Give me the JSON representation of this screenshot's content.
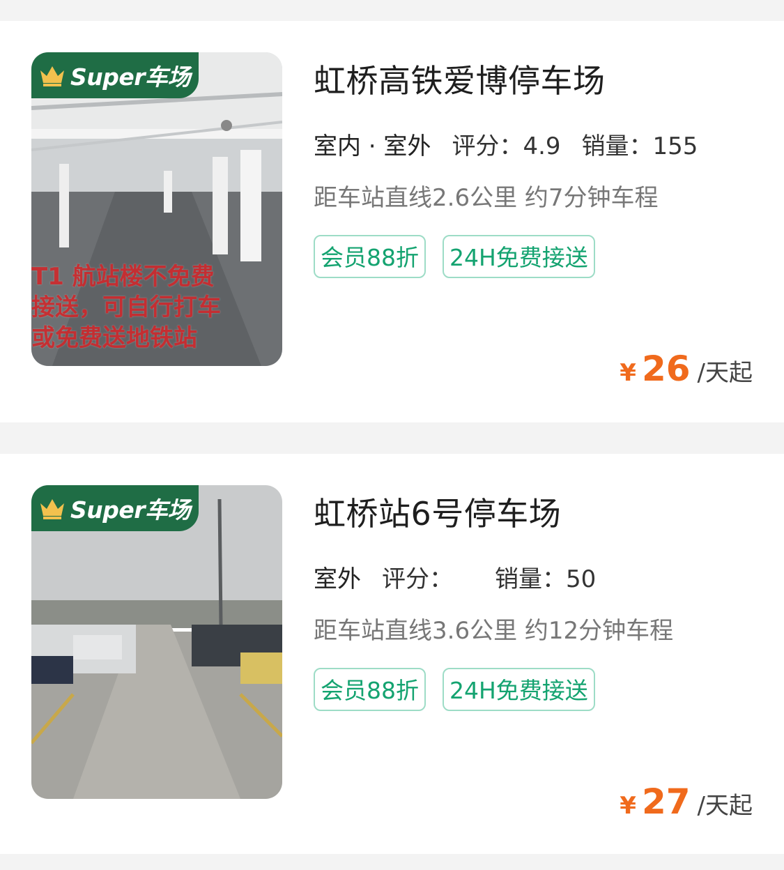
{
  "listings": [
    {
      "badge": "Super车场",
      "overlay_text": [
        "T1 航站楼不免费",
        "接送，可自行打车",
        "或免费送地铁站"
      ],
      "title": "虹桥高铁爱博停车场",
      "type": "室内 · 室外",
      "rating_label": "评分：",
      "rating": "4.9",
      "sales_label": "销量：",
      "sales": "155",
      "distance": "距车站直线2.6公里 约7分钟车程",
      "tags": [
        "会员88折",
        "24H免费接送"
      ],
      "currency": "¥",
      "price": "26",
      "price_unit": "/天起"
    },
    {
      "badge": "Super车场",
      "title": "虹桥站6号停车场",
      "type": "室外",
      "rating_label": "评分：",
      "rating": "",
      "sales_label": "销量：",
      "sales": "50",
      "distance": "距车站直线3.6公里 约12分钟车程",
      "tags": [
        "会员88折",
        "24H免费接送"
      ],
      "currency": "¥",
      "price": "27",
      "price_unit": "/天起"
    }
  ],
  "colors": {
    "accent_green": "#14a370",
    "badge_green": "#1f6d45",
    "price_orange": "#f06a1c"
  },
  "icons": [
    "crown-icon"
  ]
}
